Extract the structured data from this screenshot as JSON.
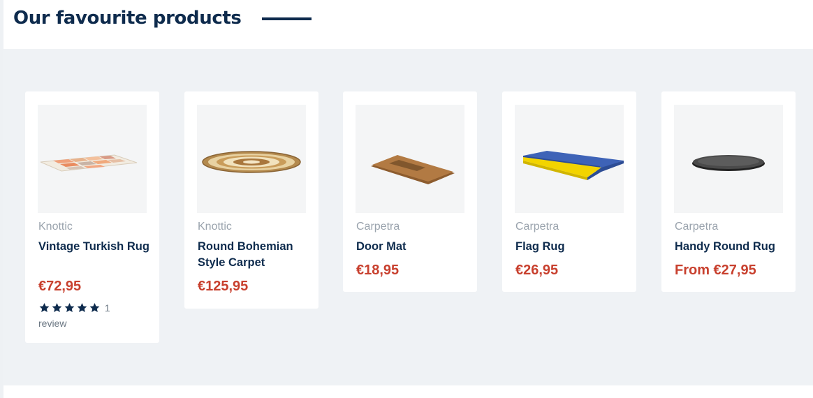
{
  "section": {
    "title": "Our favourite products"
  },
  "products": [
    {
      "brand": "Knottic",
      "name": "Vintage Turkish Rug",
      "price": "€72,95",
      "image_icon": "vintage-turkish-rug-image",
      "rating": {
        "stars": 5,
        "count": "1",
        "label": "review"
      }
    },
    {
      "brand": "Knottic",
      "name": "Round Bohemian Style Carpet",
      "price": "€125,95",
      "image_icon": "round-bohemian-carpet-image"
    },
    {
      "brand": "Carpetra",
      "name": "Door Mat",
      "price": "€18,95",
      "image_icon": "door-mat-image"
    },
    {
      "brand": "Carpetra",
      "name": "Flag Rug",
      "price": "€26,95",
      "image_icon": "flag-rug-image"
    },
    {
      "brand": "Carpetra",
      "name": "Handy Round Rug",
      "price": "From €27,95",
      "image_icon": "handy-round-rug-image"
    }
  ],
  "colors": {
    "heading": "#0e2b4d",
    "price": "#c8402e",
    "brand": "#9aa3ad",
    "band": "#eff2f5",
    "star": "#0e2b4d"
  }
}
